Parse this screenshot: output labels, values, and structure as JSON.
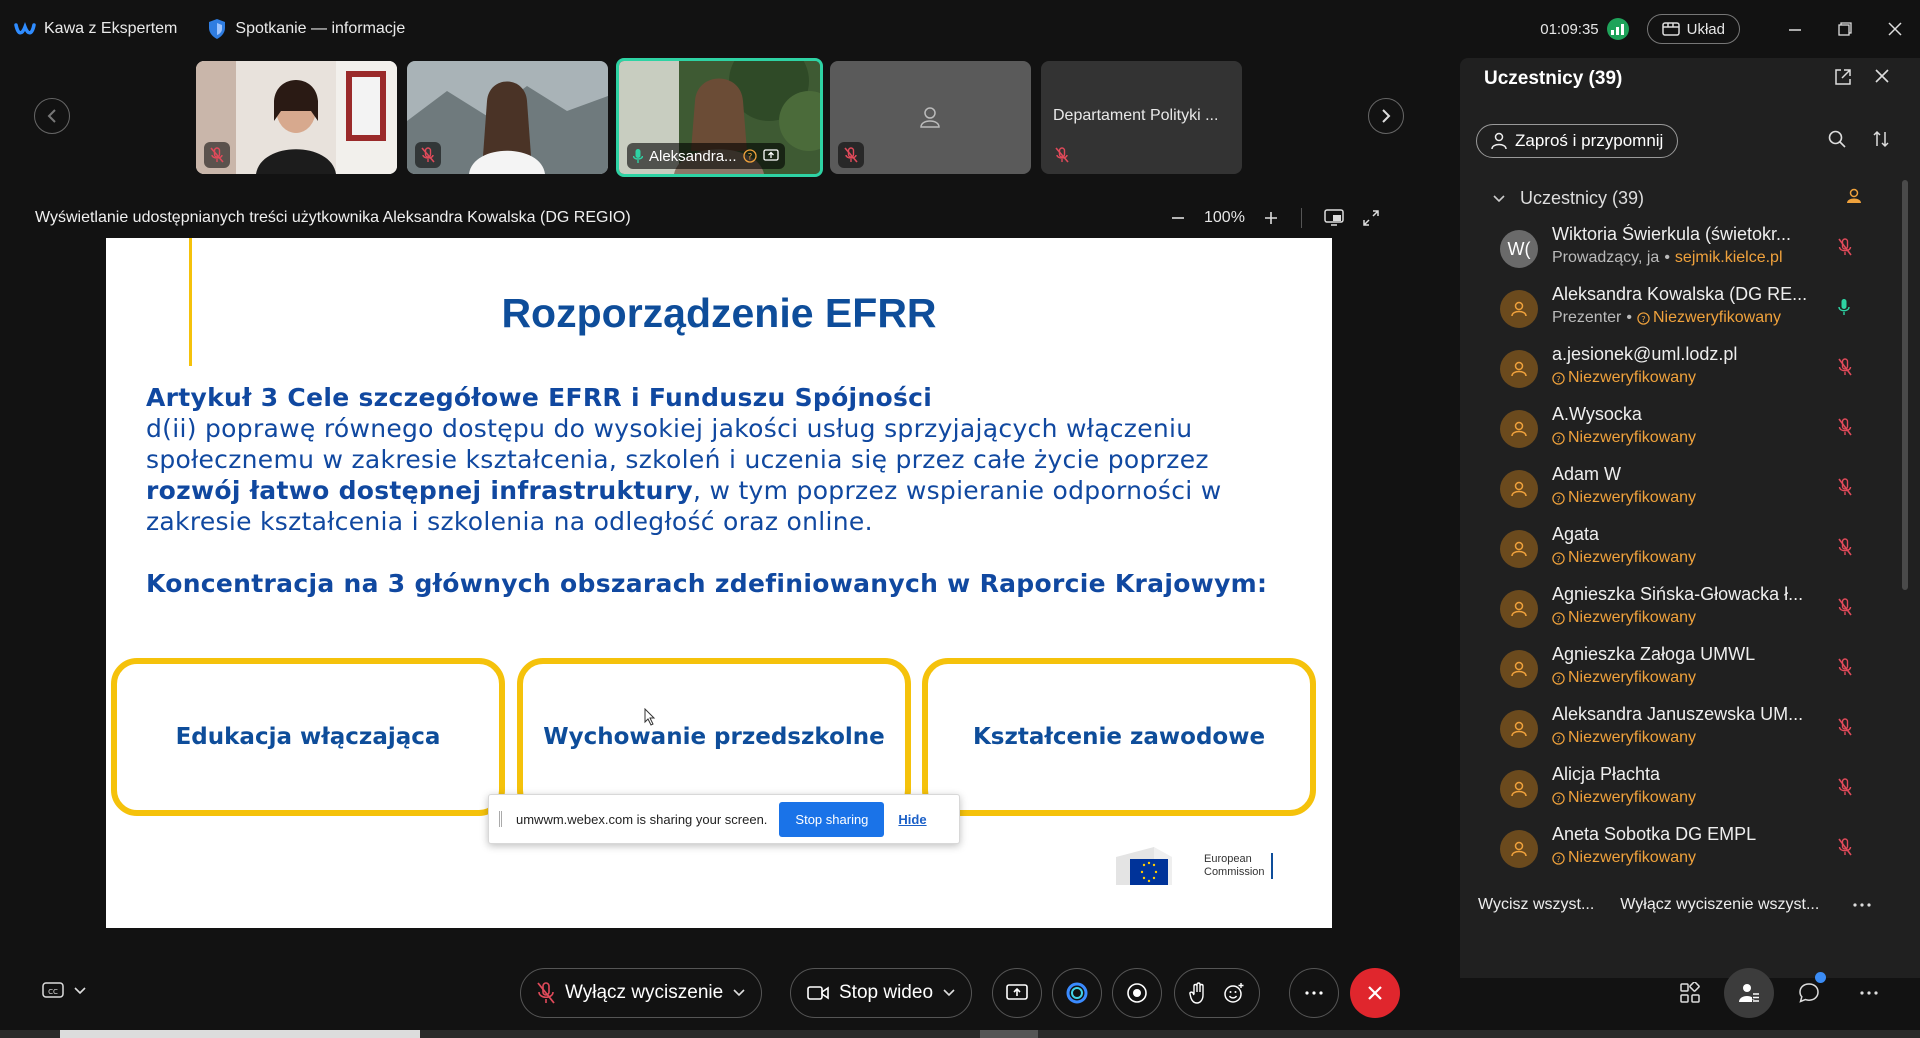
{
  "titlebar": {
    "app_name": "Kawa z Ekspertem",
    "meeting_info": "Spotkanie — informacje",
    "timer": "01:09:35",
    "layout_label": "Układ"
  },
  "thumbnails": [
    {
      "type": "video",
      "muted": true
    },
    {
      "type": "video",
      "muted": true
    },
    {
      "type": "video",
      "name": "Aleksandra...",
      "active": true
    },
    {
      "type": "avatar",
      "muted": true
    },
    {
      "type": "name",
      "name": "Departament Polityki ...",
      "muted": true
    }
  ],
  "sharing": {
    "label": "Wyświetlanie udostępnianych treści użytkownika Aleksandra Kowalska (DG REGIO)",
    "zoom": "100%"
  },
  "slide": {
    "title": "Rozporządzenie EFRR",
    "heading": "Artykuł 3 Cele szczegółowe EFRR i Funduszu Spójności",
    "line1": "d(ii) poprawę równego dostępu do wysokiej jakości usług sprzyjających włączeniu",
    "line2": "społecznemu w zakresie kształcenia, szkoleń i uczenia się przez całe życie poprzez",
    "line3_bold": "rozwój łatwo dostępnej infrastruktury",
    "line3_rest": ", w tym poprzez wspieranie odporności w",
    "line4": "zakresie kształcenia i szkolenia na odległość oraz online.",
    "focus": "Koncentracja na 3 głównych obszarach zdefiniowanych w Raporcie Krajowym:",
    "boxes": [
      "Edukacja włączająca",
      "Wychowanie przedszkolne",
      "Kształcenie zawodowe"
    ],
    "ec_logo_line1": "European",
    "ec_logo_line2": "Commission"
  },
  "share_popup": {
    "text": "umwwm.webex.com is sharing your screen.",
    "stop_label": "Stop sharing",
    "hide_label": "Hide"
  },
  "participants_panel": {
    "title": "Uczestnicy (39)",
    "invite_label": "Zaproś i przypomnij",
    "group_label": "Uczestnicy (39)",
    "list": [
      {
        "name": "Wiktoria Świerkula (świetokr...",
        "role": "Prowadzący, ja",
        "sub": "sejmik.kielce.pl",
        "initials": "W("
      },
      {
        "name": "Aleksandra Kowalska (DG RE...",
        "role": "Prezenter",
        "sub": "Niezweryfikowany",
        "mic": "on"
      },
      {
        "name": "a.jesionek@uml.lodz.pl",
        "sub": "Niezweryfikowany"
      },
      {
        "name": "A.Wysocka",
        "sub": "Niezweryfikowany"
      },
      {
        "name": "Adam W",
        "sub": "Niezweryfikowany"
      },
      {
        "name": "Agata",
        "sub": "Niezweryfikowany"
      },
      {
        "name": "Agnieszka Sińska-Głowacka ł...",
        "sub": "Niezweryfikowany"
      },
      {
        "name": "Agnieszka Załoga UMWL",
        "sub": "Niezweryfikowany"
      },
      {
        "name": "Aleksandra Januszewska UM...",
        "sub": "Niezweryfikowany"
      },
      {
        "name": "Alicja Płachta",
        "sub": "Niezweryfikowany"
      },
      {
        "name": "Aneta Sobotka DG EMPL",
        "sub": "Niezweryfikowany"
      }
    ],
    "mute_all": "Wycisz wszyst...",
    "unmute_all": "Wyłącz wyciszenie wszyst..."
  },
  "controls": {
    "unmute_label": "Wyłącz wyciszenie",
    "video_label": "Stop wideo"
  },
  "colors": {
    "slide_blue": "#0e4d9a",
    "slide_yellow": "#f5c20b",
    "warn_orange": "#f0a23c",
    "muted_red": "#e04a5a",
    "end_red": "#e0262d",
    "active_green": "#2ed3a4"
  }
}
